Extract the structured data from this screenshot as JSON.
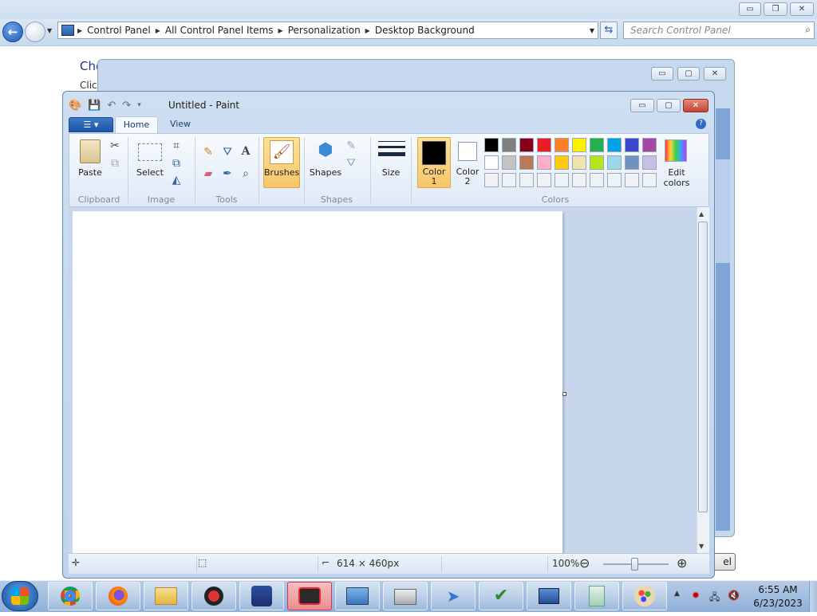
{
  "explorer": {
    "breadcrumbs": [
      "Control Panel",
      "All Control Panel Items",
      "Personalization",
      "Desktop Background"
    ],
    "search_placeholder": "Search Control Panel",
    "page_title": "Cho",
    "page_sub": "Clic",
    "window_controls": {
      "minimize": "▭",
      "restore": "❐",
      "close": "✕"
    }
  },
  "background_window": {
    "controls": {
      "minimize": "▭",
      "restore": "▢",
      "close": "✕"
    },
    "partial_button": "el"
  },
  "paint": {
    "title": "Untitled - Paint",
    "tabs": [
      "Home",
      "View"
    ],
    "groups": {
      "clipboard": {
        "label": "Clipboard",
        "paste": "Paste"
      },
      "image": {
        "label": "Image",
        "select": "Select"
      },
      "tools": {
        "label": "Tools"
      },
      "brushes": "Brushes",
      "shapes": {
        "label": "Shapes",
        "button": "Shapes"
      },
      "size": "Size",
      "colors": {
        "label": "Colors",
        "color1_a": "Color",
        "color1_b": "1",
        "color2_a": "Color",
        "color2_b": "2",
        "edit_a": "Edit",
        "edit_b": "colors"
      }
    },
    "palette_row1": [
      "#000000",
      "#7f7f7f",
      "#880015",
      "#ed1c24",
      "#ff7f27",
      "#fff200",
      "#22b14c",
      "#00a2e8",
      "#3f48cc",
      "#a349a4"
    ],
    "palette_row2": [
      "#ffffff",
      "#c3c3c3",
      "#b97a57",
      "#ffaec9",
      "#ffc90e",
      "#efe4b0",
      "#b5e61d",
      "#99d9ea",
      "#7092be",
      "#c8bfe7"
    ],
    "color1": "#000000",
    "color2": "#ffffff",
    "status": {
      "dimensions": "614 × 460px",
      "zoom": "100%",
      "zoom_out": "⊖",
      "zoom_in": "⊕"
    }
  },
  "taskbar": {
    "time": "6:55 AM",
    "date": "6/23/2023",
    "apps": [
      "chrome-icon",
      "firefox-icon",
      "folder-icon",
      "app-red-icon",
      "app-blue-icon",
      "screen-recorder-icon",
      "monitor-app-icon",
      "printer-icon",
      "paper-plane-icon",
      "notepad-check-icon",
      "network-computer-icon",
      "document-icon",
      "paint-icon"
    ]
  }
}
